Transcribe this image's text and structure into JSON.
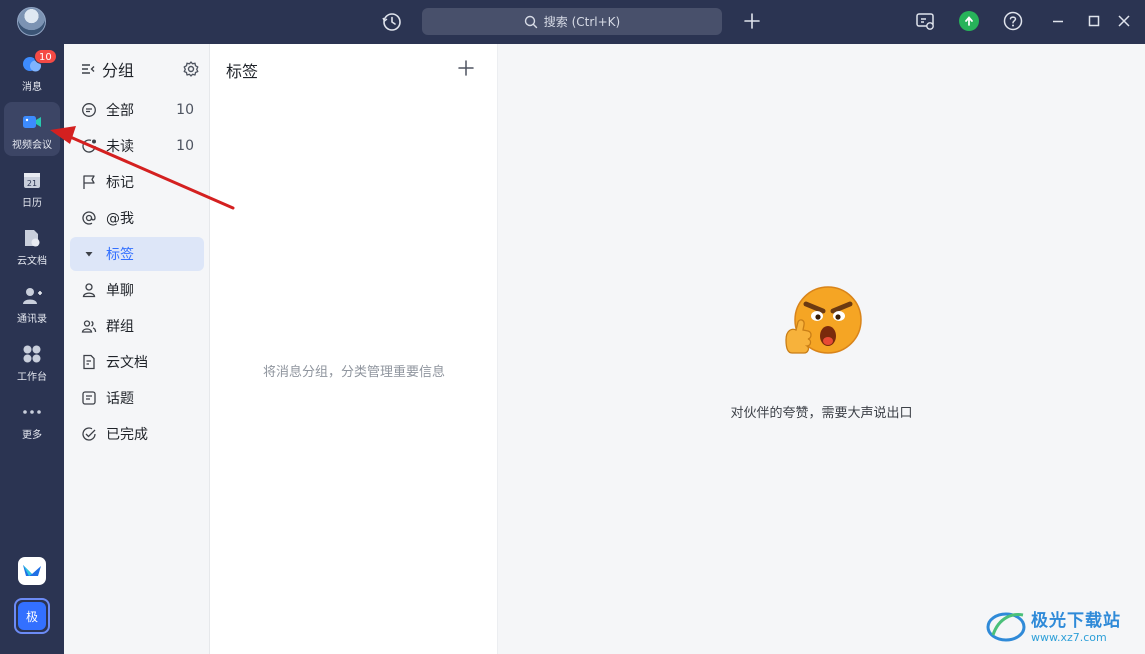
{
  "titlebar": {
    "search_placeholder": "搜索 (Ctrl+K)"
  },
  "rail": {
    "items": [
      {
        "label": "消息",
        "badge": "10"
      },
      {
        "label": "视频会议"
      },
      {
        "label": "日历"
      },
      {
        "label": "云文档"
      },
      {
        "label": "通讯录"
      },
      {
        "label": "工作台"
      },
      {
        "label": "更多"
      }
    ],
    "me_avatar_label": "极"
  },
  "groups": {
    "title": "分组",
    "items": [
      {
        "label": "全部",
        "count": "10"
      },
      {
        "label": "未读",
        "count": "10"
      },
      {
        "label": "标记"
      },
      {
        "label": "@我"
      },
      {
        "label": "标签"
      },
      {
        "label": "单聊"
      },
      {
        "label": "群组"
      },
      {
        "label": "云文档"
      },
      {
        "label": "话题"
      },
      {
        "label": "已完成"
      }
    ]
  },
  "tags": {
    "title": "标签",
    "empty_text": "将消息分组，分类管理重要信息"
  },
  "main": {
    "empty_text": "对伙伴的夸赞，需要大声说出口"
  },
  "watermark": {
    "name": "极光下载站",
    "url": "www.xz7.com"
  },
  "colors": {
    "sidebar_bg": "#2b3452",
    "accent": "#3370ff",
    "badge": "#f54a45",
    "arrow": "#d42020"
  }
}
